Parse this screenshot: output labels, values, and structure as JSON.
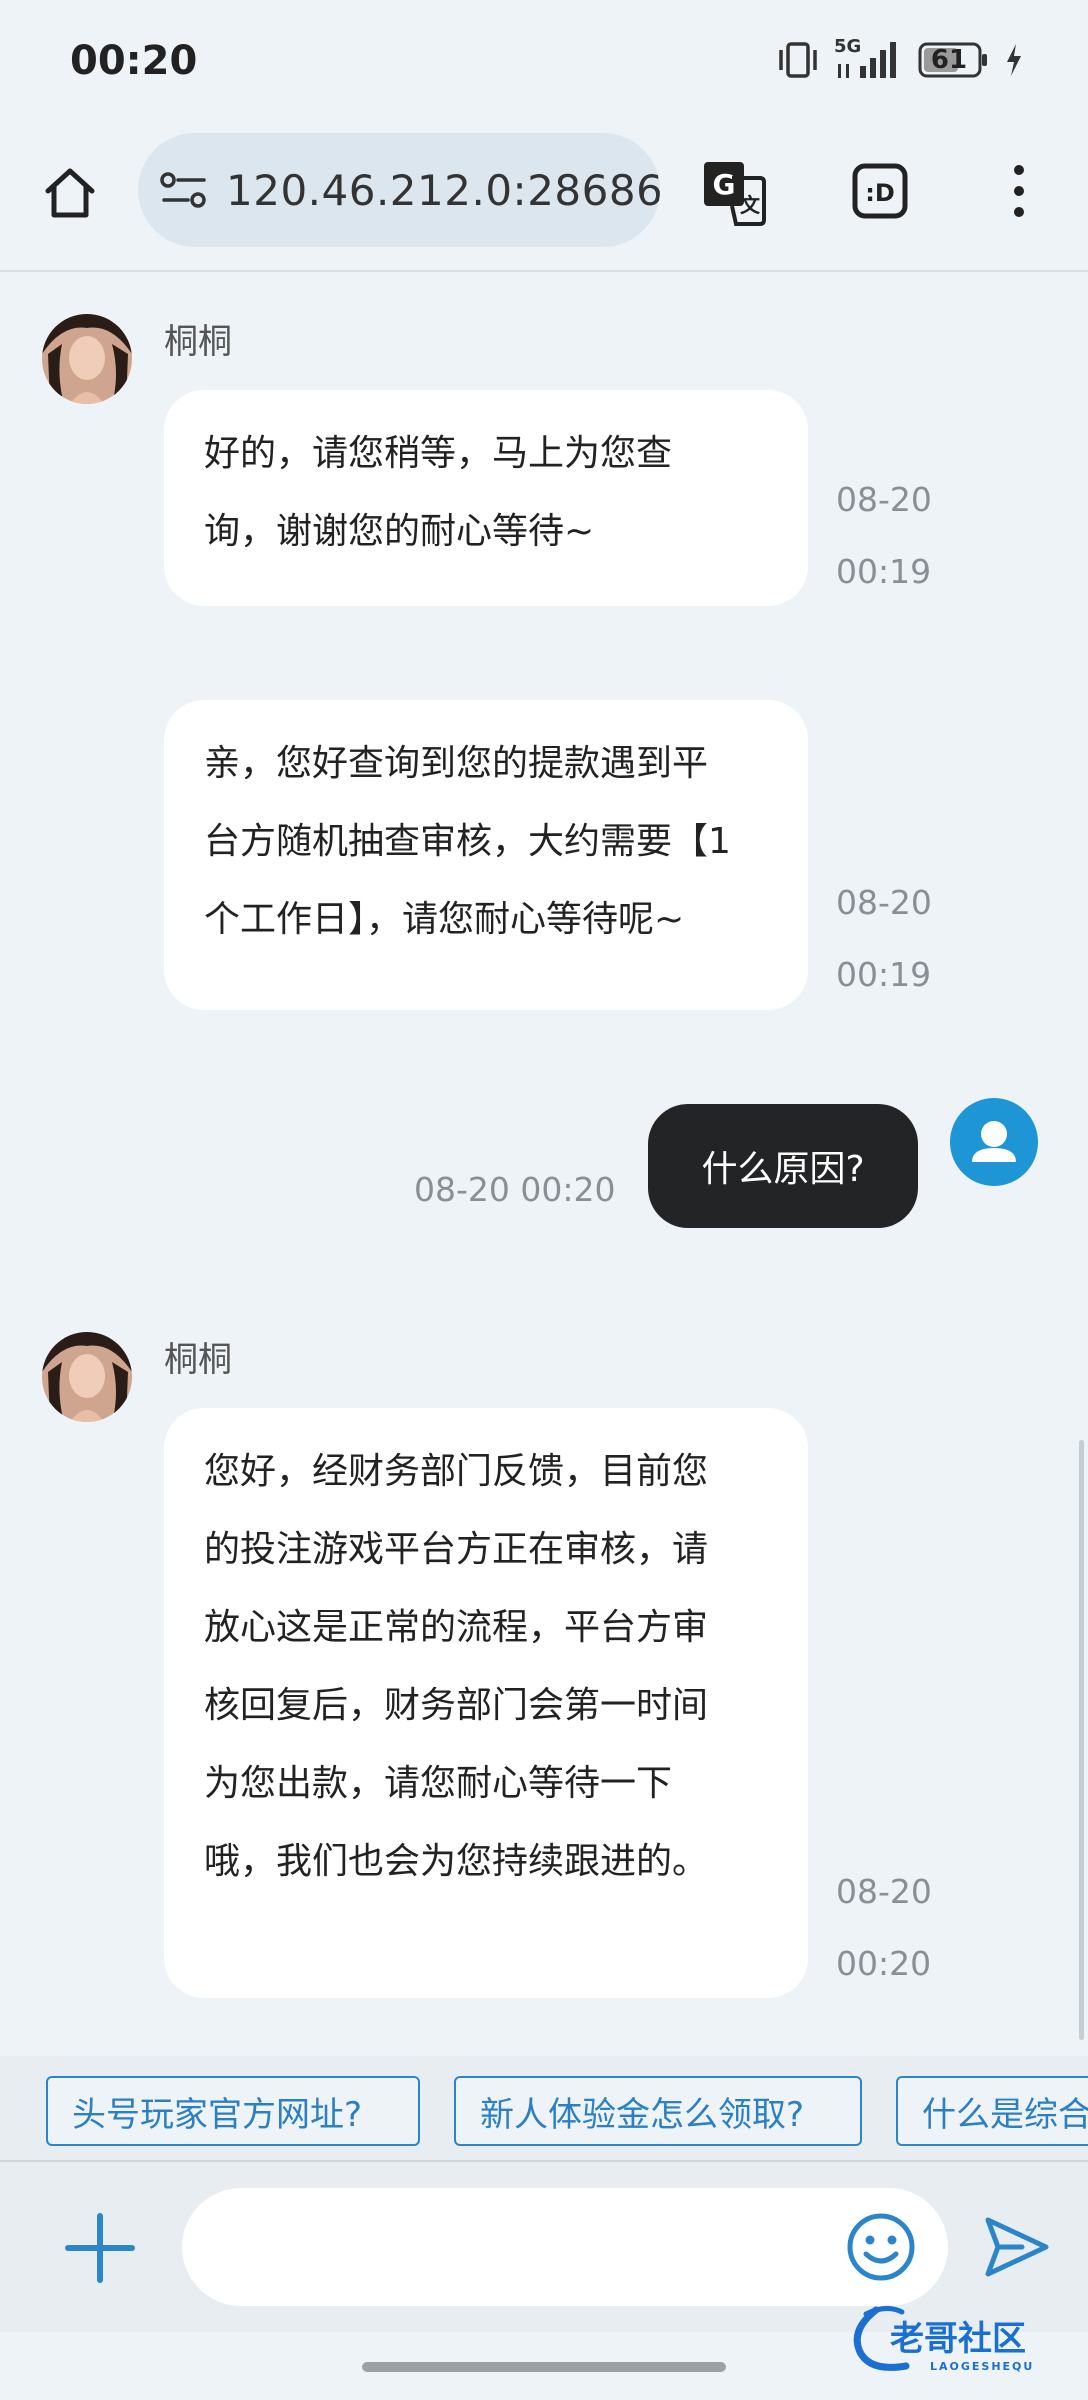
{
  "status_bar": {
    "time": "00:20",
    "network": "5G",
    "battery": "61"
  },
  "browser": {
    "url": "120.46.212.0:28686/"
  },
  "messages": [
    {
      "sender": "桐桐",
      "lines": [
        "好的，请您稍等，马上为您查",
        "询，谢谢您的耐心等待~"
      ],
      "date": "08-20",
      "time": "00:19"
    },
    {
      "lines": [
        "亲，您好查询到您的提款遇到平",
        "台方随机抽查审核，大约需要【1",
        "个工作日】，请您耐心等待呢~"
      ],
      "date": "08-20",
      "time": "00:19"
    },
    {
      "from_me": true,
      "text": "什么原因?",
      "datetime": "08-20 00:20"
    },
    {
      "sender": "桐桐",
      "lines": [
        "您好，经财务部门反馈，目前您",
        "的投注游戏平台方正在审核，请",
        "放心这是正常的流程，平台方审",
        "核回复后，财务部门会第一时间",
        "为您出款，请您耐心等待一下",
        "哦，我们也会为您持续跟进的。"
      ],
      "date": "08-20",
      "time": "00:20"
    }
  ],
  "quick_replies": [
    "头号玩家官方网址?",
    "新人体验金怎么领取?",
    "什么是综合"
  ],
  "input": {
    "placeholder": ""
  },
  "watermark": {
    "text": "老哥社区",
    "subtext": "LAOGESHEQU"
  },
  "colors": {
    "background": "#eef3f8",
    "my_bubble": "#232425",
    "accent": "#2b86c9",
    "my_avatar": "#1e96d6"
  }
}
